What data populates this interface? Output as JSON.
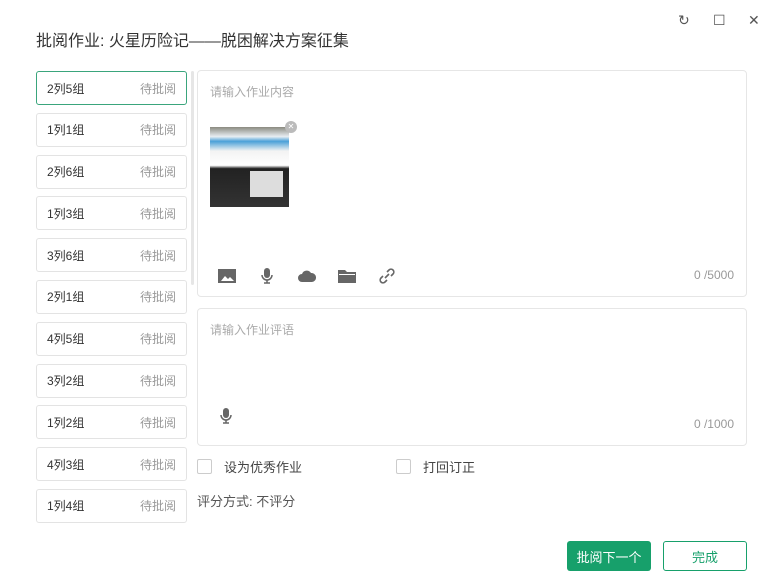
{
  "title": "批阅作业:   火星历险记——脱困解决方案征集",
  "window": {
    "refresh": "↻",
    "maximize": "☐",
    "close": "✕"
  },
  "students": [
    {
      "name": "2列5组",
      "status": "待批阅"
    },
    {
      "name": "1列1组",
      "status": "待批阅"
    },
    {
      "name": "2列6组",
      "status": "待批阅"
    },
    {
      "name": "1列3组",
      "status": "待批阅"
    },
    {
      "name": "3列6组",
      "status": "待批阅"
    },
    {
      "name": "2列1组",
      "status": "待批阅"
    },
    {
      "name": "4列5组",
      "status": "待批阅"
    },
    {
      "name": "3列2组",
      "status": "待批阅"
    },
    {
      "name": "1列2组",
      "status": "待批阅"
    },
    {
      "name": "4列3组",
      "status": "待批阅"
    },
    {
      "name": "1列4组",
      "status": "待批阅"
    }
  ],
  "content": {
    "placeholder": "请输入作业内容",
    "count": "0 /5000"
  },
  "comment": {
    "placeholder": "请输入作业评语",
    "count": "0 /1000"
  },
  "options": {
    "excellent": "设为优秀作业",
    "return": "打回订正"
  },
  "scoring": "评分方式: 不评分",
  "buttons": {
    "next": "批阅下一个",
    "done": "完成"
  },
  "colors": {
    "accent": "#17a06b"
  }
}
